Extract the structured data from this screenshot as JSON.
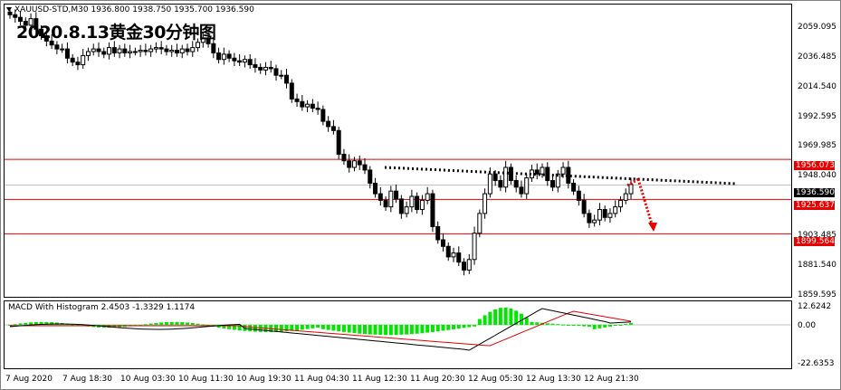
{
  "chart": {
    "symbol_header": "XAUUSD-STD,M30  1936.800 1938.750 1935.700 1936.590",
    "overlay_title": "2020.8.13黄金30分钟图",
    "macd_header": "MACD With Histogram 2.4503 -1.3329 1.1174"
  },
  "price_axis": {
    "ticks": [
      "2059.095",
      "2036.485",
      "2014.540",
      "1992.595",
      "1969.985",
      "1948.040",
      "1881.540",
      "1859.595"
    ],
    "partial_tick": "1903.485"
  },
  "levels": {
    "resistance": "1956.073",
    "current": "1936.590",
    "mid_support": "1925.637",
    "low_support": "1899.564"
  },
  "macd_axis": {
    "top": "12.6242",
    "zero": "0.00",
    "bottom": "-22.6353"
  },
  "time_axis": [
    "7 Aug 2020",
    "7 Aug 18:30",
    "10 Aug 03:30",
    "10 Aug 11:30",
    "10 Aug 19:30",
    "11 Aug 04:30",
    "11 Aug 12:30",
    "11 Aug 20:30",
    "12 Aug 05:30",
    "12 Aug 13:30",
    "12 Aug 21:30"
  ],
  "colors": {
    "level_line": "#e60000",
    "bullish": "#000000",
    "bearish": "#000000",
    "histogram": "#00e600",
    "macd_line": "#000000",
    "signal_line": "#e60000",
    "trendline": "#000000",
    "projection": "#e60000"
  }
}
